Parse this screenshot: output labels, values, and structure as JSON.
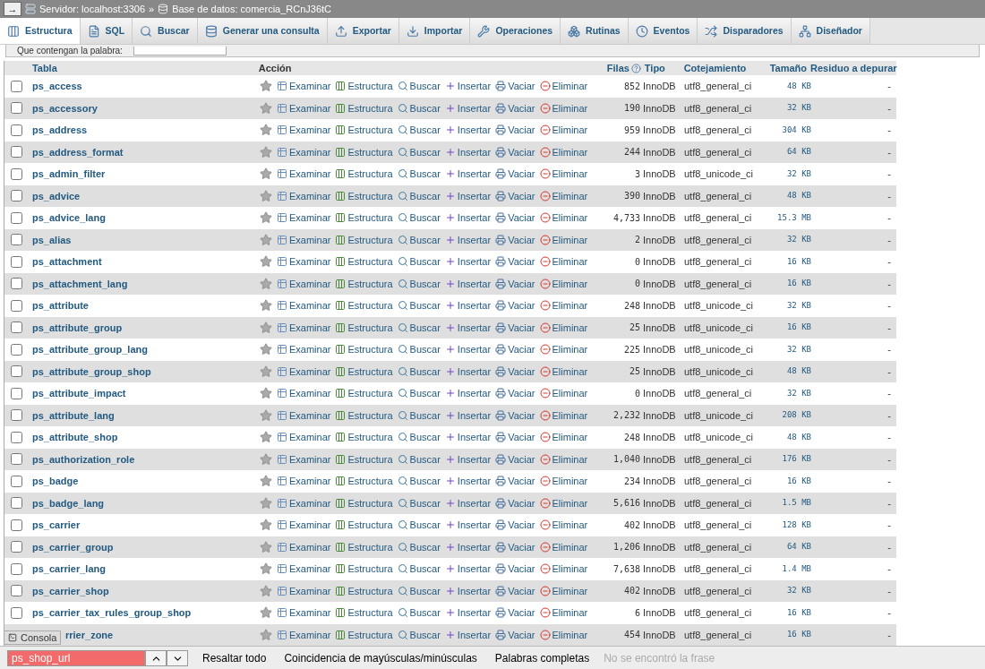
{
  "breadcrumb": {
    "toggle": "→",
    "server": "Servidor: localhost:3306",
    "separator": "»",
    "database": "Base de datos: comercia_RCnJ36tC"
  },
  "tabs": [
    {
      "label": "Estructura",
      "selected": true
    },
    {
      "label": "SQL",
      "selected": false
    },
    {
      "label": "Buscar",
      "selected": false
    },
    {
      "label": "Generar una consulta",
      "selected": false
    },
    {
      "label": "Exportar",
      "selected": false
    },
    {
      "label": "Importar",
      "selected": false
    },
    {
      "label": "Operaciones",
      "selected": false
    },
    {
      "label": "Rutinas",
      "selected": false
    },
    {
      "label": "Eventos",
      "selected": false
    },
    {
      "label": "Disparadores",
      "selected": false
    },
    {
      "label": "Diseñador",
      "selected": false
    }
  ],
  "filter": {
    "label": "Que contengan la palabra:"
  },
  "table": {
    "columns": [
      "Tabla",
      "Acción",
      "Filas",
      "Tipo",
      "Cotejamiento",
      "Tamaño",
      "Residuo a depurar"
    ],
    "rows": [
      {
        "name": "ps_access",
        "actions": [
          "Examinar",
          "Estructura",
          "Buscar",
          "Insertar",
          "Vaciar",
          "Eliminar"
        ],
        "rows": "852",
        "type": "InnoDB",
        "collation": "utf8_general_ci",
        "size": "48 KB",
        "overhead": "-",
        "checked": false
      },
      {
        "name": "ps_accessory",
        "actions": [
          "Examinar",
          "Estructura",
          "Buscar",
          "Insertar",
          "Vaciar",
          "Eliminar"
        ],
        "rows": "190",
        "type": "InnoDB",
        "collation": "utf8_general_ci",
        "size": "32 KB",
        "overhead": "-",
        "checked": false
      },
      {
        "name": "ps_address",
        "actions": [
          "Examinar",
          "Estructura",
          "Buscar",
          "Insertar",
          "Vaciar",
          "Eliminar"
        ],
        "rows": "959",
        "type": "InnoDB",
        "collation": "utf8_general_ci",
        "size": "304 KB",
        "overhead": "-",
        "checked": false
      },
      {
        "name": "ps_address_format",
        "actions": [
          "Examinar",
          "Estructura",
          "Buscar",
          "Insertar",
          "Vaciar",
          "Eliminar"
        ],
        "rows": "244",
        "type": "InnoDB",
        "collation": "utf8_general_ci",
        "size": "64 KB",
        "overhead": "-",
        "checked": false
      },
      {
        "name": "ps_admin_filter",
        "actions": [
          "Examinar",
          "Estructura",
          "Buscar",
          "Insertar",
          "Vaciar",
          "Eliminar"
        ],
        "rows": "3",
        "type": "InnoDB",
        "collation": "utf8_unicode_ci",
        "size": "32 KB",
        "overhead": "-",
        "checked": false
      },
      {
        "name": "ps_advice",
        "actions": [
          "Examinar",
          "Estructura",
          "Buscar",
          "Insertar",
          "Vaciar",
          "Eliminar"
        ],
        "rows": "390",
        "type": "InnoDB",
        "collation": "utf8_general_ci",
        "size": "48 KB",
        "overhead": "-",
        "checked": false
      },
      {
        "name": "ps_advice_lang",
        "actions": [
          "Examinar",
          "Estructura",
          "Buscar",
          "Insertar",
          "Vaciar",
          "Eliminar"
        ],
        "rows": "4,733",
        "type": "InnoDB",
        "collation": "utf8_general_ci",
        "size": "15.3 MB",
        "overhead": "-",
        "checked": false
      },
      {
        "name": "ps_alias",
        "actions": [
          "Examinar",
          "Estructura",
          "Buscar",
          "Insertar",
          "Vaciar",
          "Eliminar"
        ],
        "rows": "2",
        "type": "InnoDB",
        "collation": "utf8_general_ci",
        "size": "32 KB",
        "overhead": "-",
        "checked": false
      },
      {
        "name": "ps_attachment",
        "actions": [
          "Examinar",
          "Estructura",
          "Buscar",
          "Insertar",
          "Vaciar",
          "Eliminar"
        ],
        "rows": "0",
        "type": "InnoDB",
        "collation": "utf8_general_ci",
        "size": "16 KB",
        "overhead": "-",
        "checked": false
      },
      {
        "name": "ps_attachment_lang",
        "actions": [
          "Examinar",
          "Estructura",
          "Buscar",
          "Insertar",
          "Vaciar",
          "Eliminar"
        ],
        "rows": "0",
        "type": "InnoDB",
        "collation": "utf8_general_ci",
        "size": "16 KB",
        "overhead": "-",
        "checked": false
      },
      {
        "name": "ps_attribute",
        "actions": [
          "Examinar",
          "Estructura",
          "Buscar",
          "Insertar",
          "Vaciar",
          "Eliminar"
        ],
        "rows": "248",
        "type": "InnoDB",
        "collation": "utf8_unicode_ci",
        "size": "32 KB",
        "overhead": "-",
        "checked": false
      },
      {
        "name": "ps_attribute_group",
        "actions": [
          "Examinar",
          "Estructura",
          "Buscar",
          "Insertar",
          "Vaciar",
          "Eliminar"
        ],
        "rows": "25",
        "type": "InnoDB",
        "collation": "utf8_unicode_ci",
        "size": "16 KB",
        "overhead": "-",
        "checked": false
      },
      {
        "name": "ps_attribute_group_lang",
        "actions": [
          "Examinar",
          "Estructura",
          "Buscar",
          "Insertar",
          "Vaciar",
          "Eliminar"
        ],
        "rows": "225",
        "type": "InnoDB",
        "collation": "utf8_unicode_ci",
        "size": "32 KB",
        "overhead": "-",
        "checked": false
      },
      {
        "name": "ps_attribute_group_shop",
        "actions": [
          "Examinar",
          "Estructura",
          "Buscar",
          "Insertar",
          "Vaciar",
          "Eliminar"
        ],
        "rows": "25",
        "type": "InnoDB",
        "collation": "utf8_unicode_ci",
        "size": "48 KB",
        "overhead": "-",
        "checked": false
      },
      {
        "name": "ps_attribute_impact",
        "actions": [
          "Examinar",
          "Estructura",
          "Buscar",
          "Insertar",
          "Vaciar",
          "Eliminar"
        ],
        "rows": "0",
        "type": "InnoDB",
        "collation": "utf8_general_ci",
        "size": "32 KB",
        "overhead": "-",
        "checked": false
      },
      {
        "name": "ps_attribute_lang",
        "actions": [
          "Examinar",
          "Estructura",
          "Buscar",
          "Insertar",
          "Vaciar",
          "Eliminar"
        ],
        "rows": "2,232",
        "type": "InnoDB",
        "collation": "utf8_unicode_ci",
        "size": "208 KB",
        "overhead": "-",
        "checked": false
      },
      {
        "name": "ps_attribute_shop",
        "actions": [
          "Examinar",
          "Estructura",
          "Buscar",
          "Insertar",
          "Vaciar",
          "Eliminar"
        ],
        "rows": "248",
        "type": "InnoDB",
        "collation": "utf8_unicode_ci",
        "size": "48 KB",
        "overhead": "-",
        "checked": false
      },
      {
        "name": "ps_authorization_role",
        "actions": [
          "Examinar",
          "Estructura",
          "Buscar",
          "Insertar",
          "Vaciar",
          "Eliminar"
        ],
        "rows": "1,040",
        "type": "InnoDB",
        "collation": "utf8_general_ci",
        "size": "176 KB",
        "overhead": "-",
        "checked": false
      },
      {
        "name": "ps_badge",
        "actions": [
          "Examinar",
          "Estructura",
          "Buscar",
          "Insertar",
          "Vaciar",
          "Eliminar"
        ],
        "rows": "234",
        "type": "InnoDB",
        "collation": "utf8_general_ci",
        "size": "16 KB",
        "overhead": "-",
        "checked": false
      },
      {
        "name": "ps_badge_lang",
        "actions": [
          "Examinar",
          "Estructura",
          "Buscar",
          "Insertar",
          "Vaciar",
          "Eliminar"
        ],
        "rows": "5,616",
        "type": "InnoDB",
        "collation": "utf8_general_ci",
        "size": "1.5 MB",
        "overhead": "-",
        "checked": false
      },
      {
        "name": "ps_carrier",
        "actions": [
          "Examinar",
          "Estructura",
          "Buscar",
          "Insertar",
          "Vaciar",
          "Eliminar"
        ],
        "rows": "402",
        "type": "InnoDB",
        "collation": "utf8_general_ci",
        "size": "128 KB",
        "overhead": "-",
        "checked": false
      },
      {
        "name": "ps_carrier_group",
        "actions": [
          "Examinar",
          "Estructura",
          "Buscar",
          "Insertar",
          "Vaciar",
          "Eliminar"
        ],
        "rows": "1,206",
        "type": "InnoDB",
        "collation": "utf8_general_ci",
        "size": "64 KB",
        "overhead": "-",
        "checked": false
      },
      {
        "name": "ps_carrier_lang",
        "actions": [
          "Examinar",
          "Estructura",
          "Buscar",
          "Insertar",
          "Vaciar",
          "Eliminar"
        ],
        "rows": "7,638",
        "type": "InnoDB",
        "collation": "utf8_general_ci",
        "size": "1.4 MB",
        "overhead": "-",
        "checked": false
      },
      {
        "name": "ps_carrier_shop",
        "actions": [
          "Examinar",
          "Estructura",
          "Buscar",
          "Insertar",
          "Vaciar",
          "Eliminar"
        ],
        "rows": "402",
        "type": "InnoDB",
        "collation": "utf8_general_ci",
        "size": "32 KB",
        "overhead": "-",
        "checked": false
      },
      {
        "name": "ps_carrier_tax_rules_group_shop",
        "actions": [
          "Examinar",
          "Estructura",
          "Buscar",
          "Insertar",
          "Vaciar",
          "Eliminar"
        ],
        "rows": "6",
        "type": "InnoDB",
        "collation": "utf8_general_ci",
        "size": "16 KB",
        "overhead": "-",
        "checked": false
      },
      {
        "name": "rrier_zone",
        "actions": [
          "Examinar",
          "Estructura",
          "Buscar",
          "Insertar",
          "Vaciar",
          "Eliminar"
        ],
        "rows": "454",
        "type": "InnoDB",
        "collation": "utf8_general_ci",
        "size": "16 KB",
        "overhead": "-"
      }
    ]
  },
  "console_tab": {
    "label": "Consola"
  },
  "find_bar": {
    "value": "ps_shop_url",
    "not_found": true,
    "options": [
      "Resaltar todo",
      "Coincidencia de mayúsculas/minúsculas",
      "Palabras completas"
    ],
    "status": "No se encontró la frase"
  }
}
